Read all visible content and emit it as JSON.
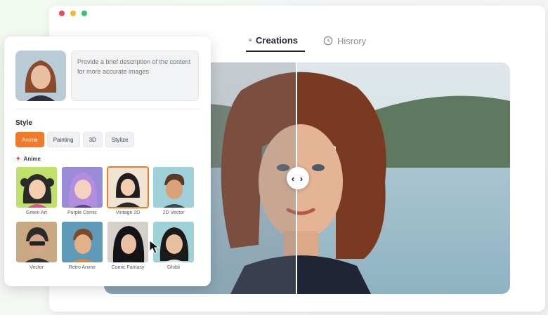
{
  "window": {
    "dots": [
      "#f0455a",
      "#f5b62a",
      "#33c46a"
    ]
  },
  "tabs": [
    {
      "label": "Creations",
      "icon": "image-icon",
      "active": true
    },
    {
      "label": "Hisrory",
      "icon": "clock-icon",
      "active": false
    }
  ],
  "preview": {
    "handle_icon": "compare-arrows-icon",
    "handle_text": "‹ ›"
  },
  "panel": {
    "description_placeholder": "Provide a brief description of the content for more accurate images",
    "style_label": "Style",
    "chips": [
      {
        "label": "Anime",
        "active": true
      },
      {
        "label": "Painting",
        "active": false
      },
      {
        "label": "3D",
        "active": false
      },
      {
        "label": "Stylize",
        "active": false
      }
    ],
    "section_label": "Anime",
    "styles": [
      {
        "label": "Green Art"
      },
      {
        "label": "Purple Comic"
      },
      {
        "label": "Vintage 2D",
        "selected": true
      },
      {
        "label": "2D Vector"
      },
      {
        "label": "Vector"
      },
      {
        "label": "Retro Anime"
      },
      {
        "label": "Comic Fantasy"
      },
      {
        "label": "Ghibli"
      }
    ]
  },
  "colors": {
    "accent": "#f07a2a",
    "text": "#1f2430"
  }
}
